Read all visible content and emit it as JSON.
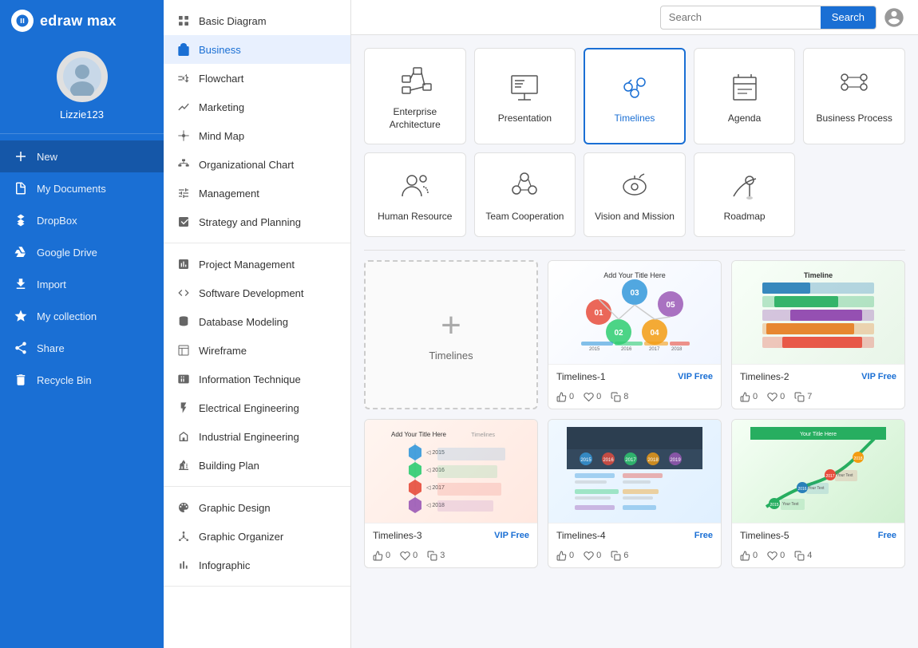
{
  "app": {
    "logo_letter": "D",
    "logo_text": "edraw max"
  },
  "user": {
    "name": "Lizzie123"
  },
  "search": {
    "placeholder": "Search",
    "button_label": "Search"
  },
  "sidebar": {
    "items": [
      {
        "id": "new",
        "label": "New",
        "icon": "plus-icon"
      },
      {
        "id": "my-documents",
        "label": "My Documents",
        "icon": "document-icon"
      },
      {
        "id": "dropbox",
        "label": "DropBox",
        "icon": "dropbox-icon"
      },
      {
        "id": "google-drive",
        "label": "Google Drive",
        "icon": "drive-icon"
      },
      {
        "id": "import",
        "label": "Import",
        "icon": "import-icon"
      },
      {
        "id": "my-collection",
        "label": "My collection",
        "icon": "star-icon"
      },
      {
        "id": "share",
        "label": "Share",
        "icon": "share-icon"
      },
      {
        "id": "recycle-bin",
        "label": "Recycle Bin",
        "icon": "trash-icon"
      }
    ]
  },
  "middle_menu": {
    "sections": [
      {
        "items": [
          {
            "id": "basic-diagram",
            "label": "Basic Diagram",
            "icon": "basic-icon"
          },
          {
            "id": "business",
            "label": "Business",
            "icon": "business-icon",
            "active": true
          },
          {
            "id": "flowchart",
            "label": "Flowchart",
            "icon": "flowchart-icon"
          },
          {
            "id": "marketing",
            "label": "Marketing",
            "icon": "marketing-icon"
          },
          {
            "id": "mind-map",
            "label": "Mind Map",
            "icon": "mindmap-icon"
          },
          {
            "id": "org-chart",
            "label": "Organizational Chart",
            "icon": "orgchart-icon"
          },
          {
            "id": "management",
            "label": "Management",
            "icon": "management-icon"
          },
          {
            "id": "strategy",
            "label": "Strategy and Planning",
            "icon": "strategy-icon"
          }
        ]
      },
      {
        "items": [
          {
            "id": "project-mgmt",
            "label": "Project Management",
            "icon": "project-icon"
          },
          {
            "id": "software-dev",
            "label": "Software Development",
            "icon": "software-icon"
          },
          {
            "id": "database",
            "label": "Database Modeling",
            "icon": "database-icon"
          },
          {
            "id": "wireframe",
            "label": "Wireframe",
            "icon": "wireframe-icon"
          },
          {
            "id": "info-tech",
            "label": "Information Technique",
            "icon": "infotech-icon"
          },
          {
            "id": "electrical",
            "label": "Electrical Engineering",
            "icon": "electrical-icon"
          },
          {
            "id": "industrial",
            "label": "Industrial Engineering",
            "icon": "industrial-icon"
          },
          {
            "id": "building",
            "label": "Building Plan",
            "icon": "building-icon"
          }
        ]
      },
      {
        "items": [
          {
            "id": "graphic-design",
            "label": "Graphic Design",
            "icon": "graphic-icon"
          },
          {
            "id": "graphic-org",
            "label": "Graphic Organizer",
            "icon": "graphicorg-icon"
          },
          {
            "id": "infographic",
            "label": "Infographic",
            "icon": "infographic-icon"
          }
        ]
      }
    ]
  },
  "categories": [
    {
      "id": "enterprise-arch",
      "label": "Enterprise\nArchitecture",
      "selected": false
    },
    {
      "id": "presentation",
      "label": "Presentation",
      "selected": false
    },
    {
      "id": "timelines",
      "label": "Timelines",
      "selected": true
    },
    {
      "id": "agenda",
      "label": "Agenda",
      "selected": false
    },
    {
      "id": "business-process",
      "label": "Business Process",
      "selected": false
    },
    {
      "id": "human-resource",
      "label": "Human Resource",
      "selected": false
    },
    {
      "id": "team-cooperation",
      "label": "Team Cooperation",
      "selected": false
    },
    {
      "id": "vision-mission",
      "label": "Vision and Mission",
      "selected": false
    },
    {
      "id": "roadmap",
      "label": "Roadmap",
      "selected": false
    }
  ],
  "templates": [
    {
      "id": "new",
      "is_new": true,
      "label": "Timelines",
      "thumb_type": "new"
    },
    {
      "id": "timelines-1",
      "label": "Timelines-1",
      "badge": "VIP Free",
      "thumb_type": "tl1",
      "likes": "0",
      "hearts": "0",
      "copies": "8"
    },
    {
      "id": "timelines-2",
      "label": "Timelines-2",
      "badge": "VIP Free",
      "thumb_type": "tl2",
      "likes": "0",
      "hearts": "0",
      "copies": "7"
    },
    {
      "id": "timelines-3",
      "label": "Timelines-3",
      "badge": "VIP Free",
      "thumb_type": "tl3",
      "likes": "0",
      "hearts": "0",
      "copies": "3"
    },
    {
      "id": "timelines-4",
      "label": "Timelines-4",
      "badge": "Free",
      "thumb_type": "tl4",
      "likes": "0",
      "hearts": "0",
      "copies": "6"
    },
    {
      "id": "timelines-5",
      "label": "Timelines-5",
      "badge": "Free",
      "thumb_type": "tl5",
      "likes": "0",
      "hearts": "0",
      "copies": "4"
    }
  ],
  "colors": {
    "primary": "#1a6fd4",
    "sidebar_bg": "#1a6fd4",
    "active_nav": "#1557a8"
  }
}
